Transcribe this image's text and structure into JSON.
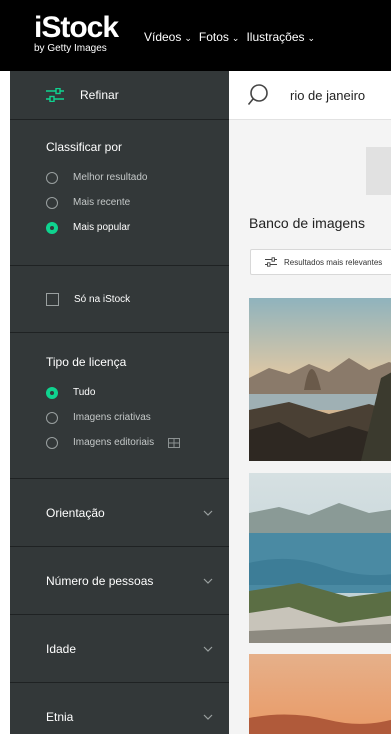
{
  "header": {
    "logo_main": "iStock",
    "logo_sub": "by Getty Images",
    "nav": [
      {
        "label": "Vídeos"
      },
      {
        "label": "Fotos"
      },
      {
        "label": "Ilustrações"
      }
    ]
  },
  "sidebar": {
    "refine_label": "Refinar",
    "sort": {
      "title": "Classificar por",
      "options": [
        {
          "label": "Melhor resultado",
          "selected": false
        },
        {
          "label": "Mais recente",
          "selected": false
        },
        {
          "label": "Mais popular",
          "selected": true
        }
      ]
    },
    "only_istock": {
      "label": "Só na iStock",
      "checked": false
    },
    "license": {
      "title": "Tipo de licença",
      "options": [
        {
          "label": "Tudo",
          "selected": true
        },
        {
          "label": "Imagens criativas",
          "selected": false
        },
        {
          "label": "Imagens editoriais",
          "selected": false
        }
      ]
    },
    "collapsed_filters": [
      {
        "label": "Orientação"
      },
      {
        "label": "Número de pessoas"
      },
      {
        "label": "Idade"
      },
      {
        "label": "Etnia"
      }
    ]
  },
  "main": {
    "search_value": "rio de janeiro",
    "results_title": "Banco de imagens",
    "filter_pill": "Resultados mais relevantes"
  },
  "colors": {
    "accent": "#0fd38f",
    "sidebar_bg": "#333839",
    "header_bg": "#000000"
  }
}
